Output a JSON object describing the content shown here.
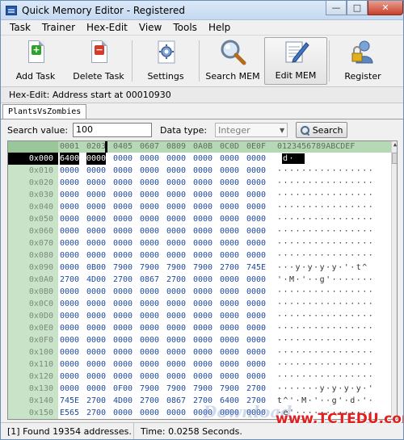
{
  "window": {
    "title": "Quick Memory Editor - Registered"
  },
  "menu": [
    "Task",
    "Trainer",
    "Hex-Edit",
    "View",
    "Tools",
    "Help"
  ],
  "toolbar": {
    "add_task": "Add Task",
    "delete_task": "Delete Task",
    "settings": "Settings",
    "search_mem": "Search MEM",
    "edit_mem": "Edit MEM",
    "register": "Register"
  },
  "subbar": {
    "text": "Hex-Edit: Address start at 00010930"
  },
  "tab": {
    "label": "PlantsVsZombies"
  },
  "search": {
    "label": "Search value:",
    "value": "100",
    "type_label": "Data type:",
    "type_value": "Integer",
    "button": "Search"
  },
  "hex": {
    "header_cols": [
      "0001",
      "0203",
      "0405",
      "0607",
      "0809",
      "0A0B",
      "0C0D",
      "0E0F"
    ],
    "header_ascii": "0123456789ABCDEF",
    "rows": [
      {
        "addr": "0x000",
        "cells": [
          "6400",
          "0000",
          "0000",
          "0000",
          "0000",
          "0000",
          "0000",
          "0000"
        ],
        "ascii": "d·              ",
        "sel": true
      },
      {
        "addr": "0x010",
        "cells": [
          "0000",
          "0000",
          "0000",
          "0000",
          "0000",
          "0000",
          "0000",
          "0000"
        ],
        "ascii": "················"
      },
      {
        "addr": "0x020",
        "cells": [
          "0000",
          "0000",
          "0000",
          "0000",
          "0000",
          "0000",
          "0000",
          "0000"
        ],
        "ascii": "················"
      },
      {
        "addr": "0x030",
        "cells": [
          "0000",
          "0000",
          "0000",
          "0000",
          "0000",
          "0000",
          "0000",
          "0000"
        ],
        "ascii": "················"
      },
      {
        "addr": "0x040",
        "cells": [
          "0000",
          "0000",
          "0000",
          "0000",
          "0000",
          "0000",
          "0000",
          "0000"
        ],
        "ascii": "················"
      },
      {
        "addr": "0x050",
        "cells": [
          "0000",
          "0000",
          "0000",
          "0000",
          "0000",
          "0000",
          "0000",
          "0000"
        ],
        "ascii": "················"
      },
      {
        "addr": "0x060",
        "cells": [
          "0000",
          "0000",
          "0000",
          "0000",
          "0000",
          "0000",
          "0000",
          "0000"
        ],
        "ascii": "················"
      },
      {
        "addr": "0x070",
        "cells": [
          "0000",
          "0000",
          "0000",
          "0000",
          "0000",
          "0000",
          "0000",
          "0000"
        ],
        "ascii": "················"
      },
      {
        "addr": "0x080",
        "cells": [
          "0000",
          "0000",
          "0000",
          "0000",
          "0000",
          "0000",
          "0000",
          "0000"
        ],
        "ascii": "················"
      },
      {
        "addr": "0x090",
        "cells": [
          "0000",
          "0B00",
          "7900",
          "7900",
          "7900",
          "7900",
          "2700",
          "745E"
        ],
        "ascii": "···y·y·y·y·'·t^"
      },
      {
        "addr": "0x0A0",
        "cells": [
          "2700",
          "4D00",
          "2700",
          "0867",
          "2700",
          "0000",
          "0000",
          "0000"
        ],
        "ascii": "'·M·'··g'·······"
      },
      {
        "addr": "0x0B0",
        "cells": [
          "0000",
          "0000",
          "0000",
          "0000",
          "0000",
          "0000",
          "0000",
          "0000"
        ],
        "ascii": "················"
      },
      {
        "addr": "0x0C0",
        "cells": [
          "0000",
          "0000",
          "0000",
          "0000",
          "0000",
          "0000",
          "0000",
          "0000"
        ],
        "ascii": "················"
      },
      {
        "addr": "0x0D0",
        "cells": [
          "0000",
          "0000",
          "0000",
          "0000",
          "0000",
          "0000",
          "0000",
          "0000"
        ],
        "ascii": "················"
      },
      {
        "addr": "0x0E0",
        "cells": [
          "0000",
          "0000",
          "0000",
          "0000",
          "0000",
          "0000",
          "0000",
          "0000"
        ],
        "ascii": "················"
      },
      {
        "addr": "0x0F0",
        "cells": [
          "0000",
          "0000",
          "0000",
          "0000",
          "0000",
          "0000",
          "0000",
          "0000"
        ],
        "ascii": "················"
      },
      {
        "addr": "0x100",
        "cells": [
          "0000",
          "0000",
          "0000",
          "0000",
          "0000",
          "0000",
          "0000",
          "0000"
        ],
        "ascii": "················"
      },
      {
        "addr": "0x110",
        "cells": [
          "0000",
          "0000",
          "0000",
          "0000",
          "0000",
          "0000",
          "0000",
          "0000"
        ],
        "ascii": "················"
      },
      {
        "addr": "0x120",
        "cells": [
          "0000",
          "0000",
          "0000",
          "0000",
          "0000",
          "0000",
          "0000",
          "0000"
        ],
        "ascii": "················"
      },
      {
        "addr": "0x130",
        "cells": [
          "0000",
          "0000",
          "0F00",
          "7900",
          "7900",
          "7900",
          "7900",
          "2700"
        ],
        "ascii": "·······y·y·y·y·'"
      },
      {
        "addr": "0x140",
        "cells": [
          "745E",
          "2700",
          "4D00",
          "2700",
          "0867",
          "2700",
          "6400",
          "2700"
        ],
        "ascii": "t^'·M·'··g'·d·'·"
      },
      {
        "addr": "0x150",
        "cells": [
          "E565",
          "2700",
          "0000",
          "0000",
          "0000",
          "0000",
          "0000",
          "0000"
        ],
        "ascii": "·e'·············"
      }
    ]
  },
  "status": {
    "found": "[1] Found 19354 addresses.",
    "time": "Time:  0.0258 Seconds."
  },
  "watermark": {
    "text": "www.TCTEDU.com",
    "faint": "Download"
  }
}
